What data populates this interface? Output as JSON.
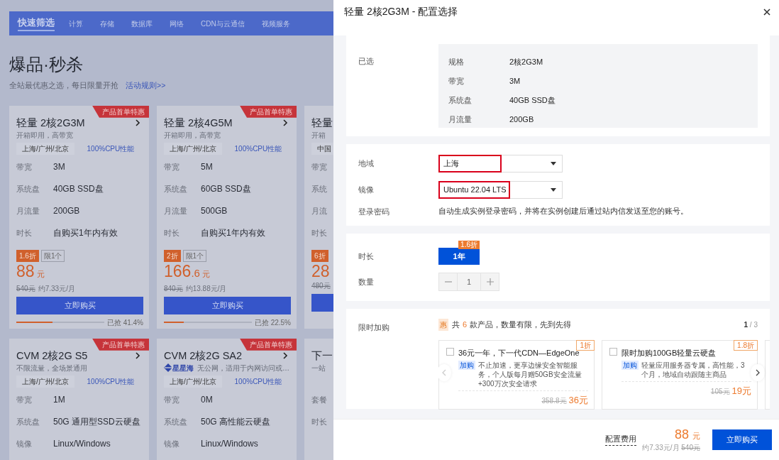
{
  "nav": {
    "brand": "快速筛选",
    "items": [
      {
        "label": "计算"
      },
      {
        "label": "存储"
      },
      {
        "label": "数据库"
      },
      {
        "label": "网络"
      },
      {
        "label": "CDN与云通信"
      },
      {
        "label": "视频服务"
      }
    ]
  },
  "hero": {
    "title": "爆品·秒杀",
    "subtitle": "全站最优惠之选，每日限量开抢",
    "link": "活动规则>>"
  },
  "products": [
    {
      "kind": "full",
      "ribbon": "产品首单特惠",
      "title": "轻量 2核2G3M",
      "subtitle": "开箱即用，高带宽",
      "regions": "上海/广州/北京",
      "cpu": "100%CPU性能",
      "specs": [
        {
          "label": "带宽",
          "value": "3M"
        },
        {
          "label": "系统盘",
          "value": "40GB SSD盘"
        },
        {
          "label": "月流量",
          "value": "200GB"
        },
        {
          "label": "时长",
          "value": "自购买1年内有效"
        }
      ],
      "discount": "1.6折",
      "limit": "限1个",
      "price": "88",
      "price_unit": "元",
      "original": "540元",
      "monthly": "约7.33元/月",
      "buy": "立即购买",
      "sold": "已抢 41.4%",
      "level": 0.414
    },
    {
      "kind": "full",
      "ribbon": "产品首单特惠",
      "title": "轻量 2核4G5M",
      "subtitle": "开箱即用，高带宽",
      "regions": "上海/广州/北京",
      "cpu": "100%CPU性能",
      "specs": [
        {
          "label": "带宽",
          "value": "5M"
        },
        {
          "label": "系统盘",
          "value": "60GB SSD盘"
        },
        {
          "label": "月流量",
          "value": "500GB"
        },
        {
          "label": "时长",
          "value": "自购买1年内有效"
        }
      ],
      "discount": "2折",
      "limit": "限1个",
      "price": "166",
      "price_decimal": ".6",
      "price_unit": "元",
      "original": "840元",
      "monthly": "约13.88元/月",
      "buy": "立即购买",
      "sold": "已抢 22.5%",
      "level": 0.225
    },
    {
      "kind": "edge",
      "title": "轻量",
      "subtitle": "开箱",
      "regions": "中国",
      "specs": [
        {
          "label": "带宽"
        },
        {
          "label": "系统"
        },
        {
          "label": "月流"
        },
        {
          "label": "时长"
        }
      ],
      "discount": "6折",
      "price": "28",
      "original": "480元"
    },
    {
      "kind": "full",
      "ribbon": "产品首单特惠",
      "title": "CVM 2核2G S5",
      "subtitle": "不限流量，全场景通用",
      "regions": "上海/广州/北京",
      "cpu": "100%CPU性能",
      "specs": [
        {
          "label": "带宽",
          "value": "1M"
        },
        {
          "label": "系统盘",
          "value": "50G 通用型SSD云硬盘"
        },
        {
          "label": "镜像",
          "value": "Linux/Windows"
        }
      ]
    },
    {
      "kind": "full",
      "ribbon": "产品首单特惠",
      "title": "CVM 2核2G SA2",
      "brand_tag": "星星海",
      "subtitle": "无公网，适用于内网访问或…",
      "regions": "上海/广州/北京",
      "cpu": "100%CPU性能",
      "specs": [
        {
          "label": "带宽",
          "value": "0M"
        },
        {
          "label": "系统盘",
          "value": "50G 高性能云硬盘"
        },
        {
          "label": "镜像",
          "value": "Linux/Windows"
        }
      ]
    },
    {
      "kind": "edge",
      "title": "下一",
      "subtitle": "一站",
      "specs": [
        {
          "label": "套餐"
        },
        {
          "label": "时长"
        }
      ]
    }
  ],
  "drawer": {
    "title": "轻量 2核2G3M - 配置选择",
    "selected": {
      "label": "已选",
      "rows": [
        {
          "label": "规格",
          "value": "2核2G3M"
        },
        {
          "label": "带宽",
          "value": "3M"
        },
        {
          "label": "系统盘",
          "value": "40GB SSD盘"
        },
        {
          "label": "月流量",
          "value": "200GB"
        }
      ]
    },
    "region": {
      "label": "地域",
      "value": "上海",
      "highlighted": true
    },
    "image": {
      "label": "镜像",
      "value": "Ubuntu 22.04 LTS",
      "highlighted": true
    },
    "password": {
      "label": "登录密码",
      "text": "自动生成实例登录密码，并将在实例创建后通过站内信发送至您的账号。"
    },
    "duration": {
      "label": "时长",
      "options": [
        {
          "label": "1年",
          "badge": "1.6折",
          "selected": true
        }
      ]
    },
    "quantity": {
      "label": "数量",
      "value": "1"
    },
    "addons": {
      "label": "限时加购",
      "icon": "惠",
      "count_prefix": "共",
      "count": "6",
      "count_suffix": "款产品，数量有限，先到先得",
      "page": "1",
      "page_rest": "/ 3",
      "items": [
        {
          "badge": "1折",
          "checked": false,
          "title": "36元一年，下一代CDN—EdgeOne",
          "tag": "加购",
          "desc": "不止加速，更享边缘安全智能服务，个人版每月赠50GB安全流量+300万次安全请求",
          "original": "358.8元",
          "price": "36元"
        },
        {
          "badge": "1.8折",
          "checked": false,
          "title": "限时加购100GB轻量云硬盘",
          "tag": "加购",
          "desc": "轻量应用服务器专属，高性能，3个月，地域自动跟随主商品",
          "original": "105元",
          "price": "19元"
        }
      ]
    },
    "footer": {
      "fee_label": "配置费用",
      "price": "88",
      "unit": "元",
      "monthly": "约7.33元/月",
      "original": "540元",
      "buy": "立即购买"
    }
  }
}
